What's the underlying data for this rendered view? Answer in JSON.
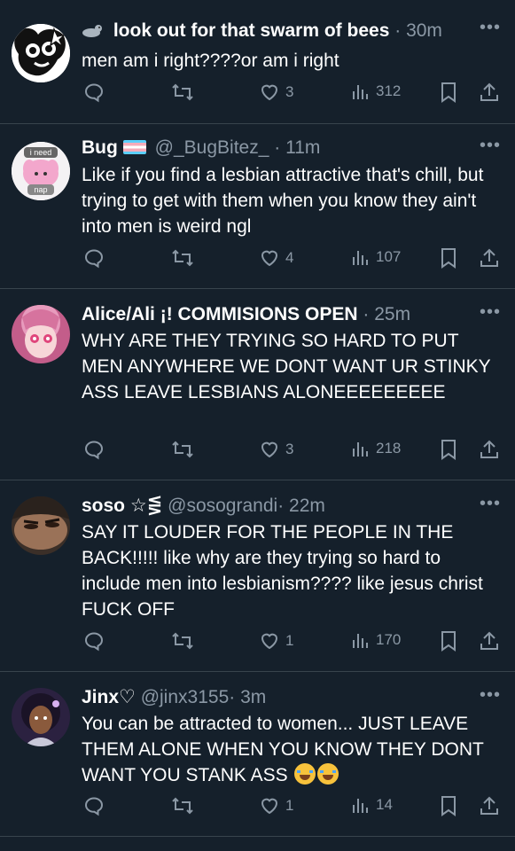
{
  "posts": [
    {
      "name": "look out for that swarm of bees",
      "badge_icon": "seal-emoji-icon",
      "handle": "",
      "time": "30m",
      "text": "men am i right????or am i right",
      "likes": "3",
      "views": "312",
      "avatar_colors": [
        "#ffffff",
        "#000000"
      ]
    },
    {
      "name": "Bug",
      "badge_icon": "trans-flag-icon",
      "handle": "@_BugBitez_",
      "time": "11m",
      "text": "Like if you find a lesbian attractive that's chill, but trying to get with them when you know they ain't into men is weird ngl",
      "likes": "4",
      "views": "107",
      "avatar_colors": [
        "#f4f2f4",
        "#f19bc7"
      ],
      "avatar_text_top": "i need",
      "avatar_text_bottom": "nap"
    },
    {
      "name": "Alice/Ali ¡! COMMISIONS OPEN",
      "handle": "",
      "time": "25m",
      "text": "WHY ARE THEY TRYING SO HARD TO PUT MEN ANYWHERE WE DONT WANT UR STINKY ASS LEAVE LESBIANS ALONEEEEEEEEE",
      "likes": "3",
      "views": "218",
      "avatar_colors": [
        "#e8a6c0",
        "#b7497a"
      ]
    },
    {
      "name": "soso ☆⋚",
      "handle": "@sosograndi",
      "time": "22m",
      "text": "SAY IT LOUDER FOR THE PEOPLE IN THE BACK!!!!! like why are they trying so hard to include men into lesbianism???? like jesus christ FUCK OFF",
      "likes": "1",
      "views": "170",
      "avatar_colors": [
        "#7a5a42",
        "#2c2520"
      ]
    },
    {
      "name": "Jinx♡",
      "handle": "@jinx3155",
      "time": "3m",
      "text": "You can be attracted to women... JUST LEAVE THEM ALONE WHEN YOU KNOW THEY DONT WANT YOU STANK ASS",
      "text_emoji_icons": [
        "loudly-crying-face-icon",
        "loudly-crying-face-icon"
      ],
      "likes": "1",
      "views": "14",
      "avatar_colors": [
        "#3a2a4e",
        "#8a5a3c"
      ]
    }
  ],
  "colors": {
    "background": "#15202b",
    "muted": "#8b98a5",
    "divider": "#38444d",
    "text": "#ffffff"
  },
  "separator": "·",
  "more_glyph": "•••"
}
